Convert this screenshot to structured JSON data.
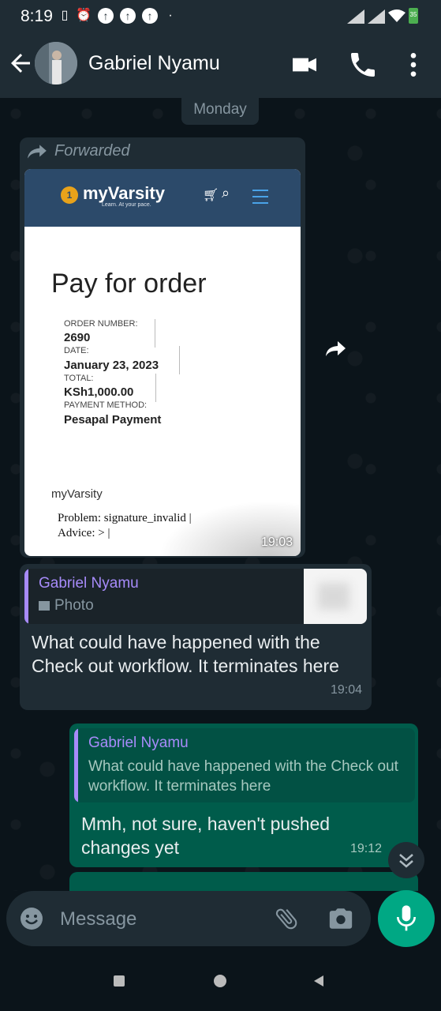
{
  "status_bar": {
    "time": "8:19",
    "battery": "35"
  },
  "header": {
    "contact_name": "Gabriel Nyamu"
  },
  "chat": {
    "day_label": "Monday",
    "forwarded_message": {
      "forwarded_label": "Forwarded",
      "time": "19:03",
      "screenshot": {
        "site_logo": "myVarsity",
        "site_tagline": "Learn. At your pace.",
        "page_title": "Pay for order",
        "order_number_label": "ORDER NUMBER:",
        "order_number": "2690",
        "date_label": "DATE:",
        "date": "January 23, 2023",
        "total_label": "TOTAL:",
        "total": "KSh1,000.00",
        "payment_method_label": "PAYMENT METHOD:",
        "payment_method": "Pesapal Payment",
        "brand": "myVarsity",
        "problem_line": "Problem: signature_invalid |",
        "advice_line": "Advice: > |"
      }
    },
    "reply_in": {
      "quoted_name": "Gabriel Nyamu",
      "quoted_type": "Photo",
      "text": "What could have happened with the Check out workflow. It terminates here",
      "time": "19:04"
    },
    "reply_out": {
      "quoted_name": "Gabriel Nyamu",
      "quoted_text": "What could have happened with the Check out workflow. It terminates here",
      "text": "Mmh, not sure, haven't pushed changes yet",
      "time": "19:12"
    }
  },
  "composer": {
    "placeholder": "Message"
  },
  "icons": {
    "back": "arrow-left-icon",
    "video": "video-call-icon",
    "call": "phone-icon",
    "menu": "more-vert-icon",
    "forward": "forward-icon",
    "emoji": "emoji-icon",
    "attach": "paperclip-icon",
    "camera": "camera-icon",
    "mic": "mic-icon"
  },
  "colors": {
    "header_bg": "#1f2c34",
    "incoming_bubble": "#1f2c34",
    "outgoing_bubble": "#005c4b",
    "accent": "#00a884",
    "quote_name": "#a78bfa"
  }
}
